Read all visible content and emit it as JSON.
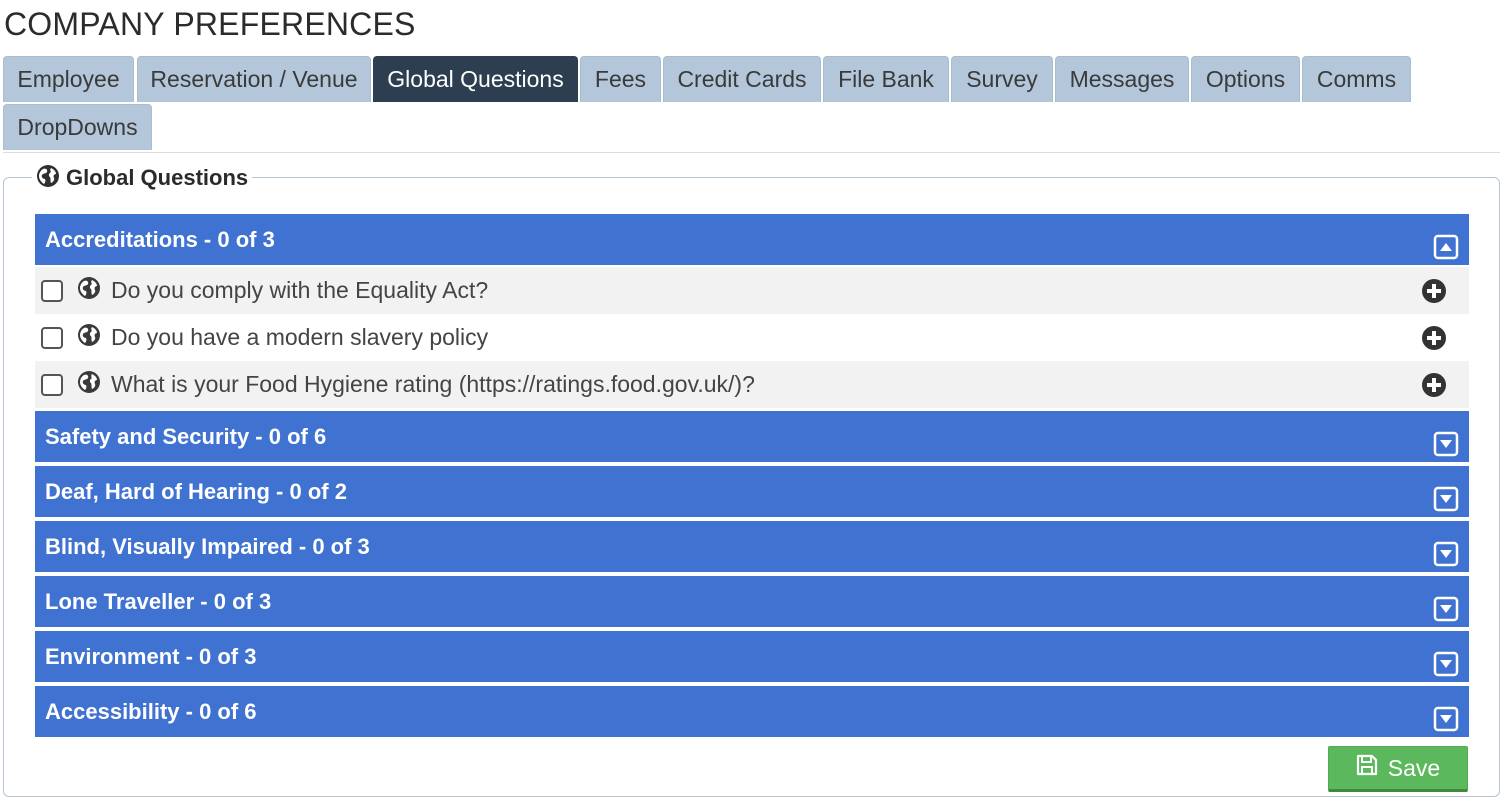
{
  "page": {
    "title": "COMPANY PREFERENCES"
  },
  "tabs": [
    {
      "label": "Employee"
    },
    {
      "label": "Reservation / Venue"
    },
    {
      "label": "Global Questions",
      "active": true
    },
    {
      "label": "Fees"
    },
    {
      "label": "Credit Cards"
    },
    {
      "label": "File Bank"
    },
    {
      "label": "Survey"
    },
    {
      "label": "Messages"
    },
    {
      "label": "Options"
    },
    {
      "label": "Comms"
    },
    {
      "label": "DropDowns"
    }
  ],
  "panel": {
    "legend": "Global Questions",
    "legend_icon": "globe-icon"
  },
  "sections": [
    {
      "title": "Accreditations - 0 of 3",
      "expanded": true,
      "toggle_icon": "collapse-up-icon",
      "questions": [
        {
          "text": "Do you comply with the Equality Act?",
          "checked": false
        },
        {
          "text": "Do you have a modern slavery policy",
          "checked": false
        },
        {
          "text": "What is your Food Hygiene rating (https://ratings.food.gov.uk/)?",
          "checked": false
        }
      ]
    },
    {
      "title": "Safety and Security - 0 of 6",
      "expanded": false,
      "toggle_icon": "expand-down-icon"
    },
    {
      "title": "Deaf, Hard of Hearing - 0 of 2",
      "expanded": false,
      "toggle_icon": "expand-down-icon"
    },
    {
      "title": "Blind, Visually Impaired - 0 of 3",
      "expanded": false,
      "toggle_icon": "expand-down-icon"
    },
    {
      "title": "Lone Traveller - 0 of 3",
      "expanded": false,
      "toggle_icon": "expand-down-icon"
    },
    {
      "title": "Environment - 0 of 3",
      "expanded": false,
      "toggle_icon": "expand-down-icon"
    },
    {
      "title": "Accessibility - 0 of 6",
      "expanded": false,
      "toggle_icon": "expand-down-icon"
    }
  ],
  "actions": {
    "save_label": "Save",
    "save_icon": "floppy-disk-icon"
  },
  "colors": {
    "section_header": "#3f72d1",
    "tab": "#b3c6da",
    "tab_active": "#2c3e50",
    "save_button": "#5cb85c"
  }
}
